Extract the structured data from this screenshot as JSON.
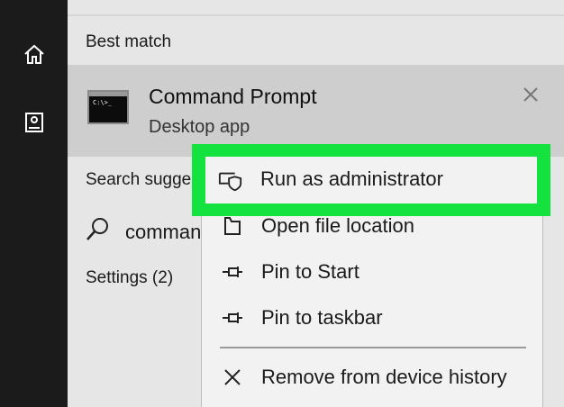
{
  "rail": {
    "icons": [
      "home-icon",
      "documents-icon"
    ]
  },
  "results": {
    "best_match_header": "Best match",
    "best_match": {
      "app_name": "Command Prompt",
      "app_type": "Desktop app",
      "icon": "command-prompt-icon",
      "icon_text": "C:\\>_"
    },
    "search_suggestions_header": "Search sugge",
    "search_suggestion": "comman",
    "settings_header": "Settings (2)"
  },
  "context_menu": {
    "items": [
      {
        "label": "Run as administrator",
        "icon": "shield-icon"
      },
      {
        "label": "Open file location",
        "icon": "folder-icon"
      },
      {
        "label": "Pin to Start",
        "icon": "pin-icon"
      },
      {
        "label": "Pin to taskbar",
        "icon": "pin-icon"
      },
      {
        "label": "Remove from device history",
        "icon": "close-icon"
      }
    ]
  },
  "colors": {
    "highlight": "#14e33f",
    "rail": "#1b1b1b",
    "panel": "#e6e6e6",
    "best_match_bg": "#cecece",
    "menu_bg": "#f2f2f2"
  }
}
